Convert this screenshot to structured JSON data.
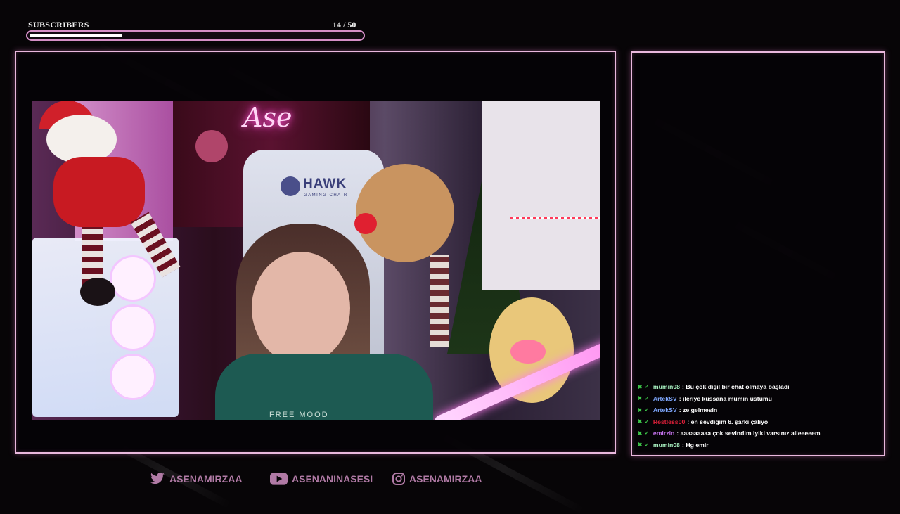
{
  "subscriber_goal": {
    "label": "SUBSCRIBERS",
    "current": 14,
    "target": 50,
    "count_text": "14  / 50",
    "progress_fraction": 0.28
  },
  "webcam": {
    "neon_sign": "Ase",
    "chair_brand": "HAWK",
    "chair_subtitle": "GAMING CHAIR",
    "shirt_text": "FREE MOOD"
  },
  "chat": {
    "messages": [
      {
        "user": "mumin08",
        "user_color": "#a8f0c0",
        "text": ": Bu çok dişil bir chat olmaya başladı"
      },
      {
        "user": "ArtekSV",
        "user_color": "#7fa8ff",
        "text": ": ileriye kussana mumin üstümü"
      },
      {
        "user": "ArtekSV",
        "user_color": "#7fa8ff",
        "text": ": ze gelmesin"
      },
      {
        "user": "Restless00",
        "user_color": "#e0203a",
        "text": ": en sevdiğim 6. şarkı çalıyo"
      },
      {
        "user": "emirzin",
        "user_color": "#c070e8",
        "text": ": aaaaaaaaa çok sevindim iyiki varsınız aileeeeem"
      },
      {
        "user": "mumin08",
        "user_color": "#a8f0c0",
        "text": ": Hg emir"
      }
    ]
  },
  "socials": {
    "twitter": "ASENAMIRZAA",
    "youtube": "ASENANINASESI",
    "instagram": "ASENAMIRZAA"
  },
  "colors": {
    "frame_border": "#e9b8dd",
    "social_text": "#b07aa5",
    "badge_green": "#3ec84a"
  }
}
